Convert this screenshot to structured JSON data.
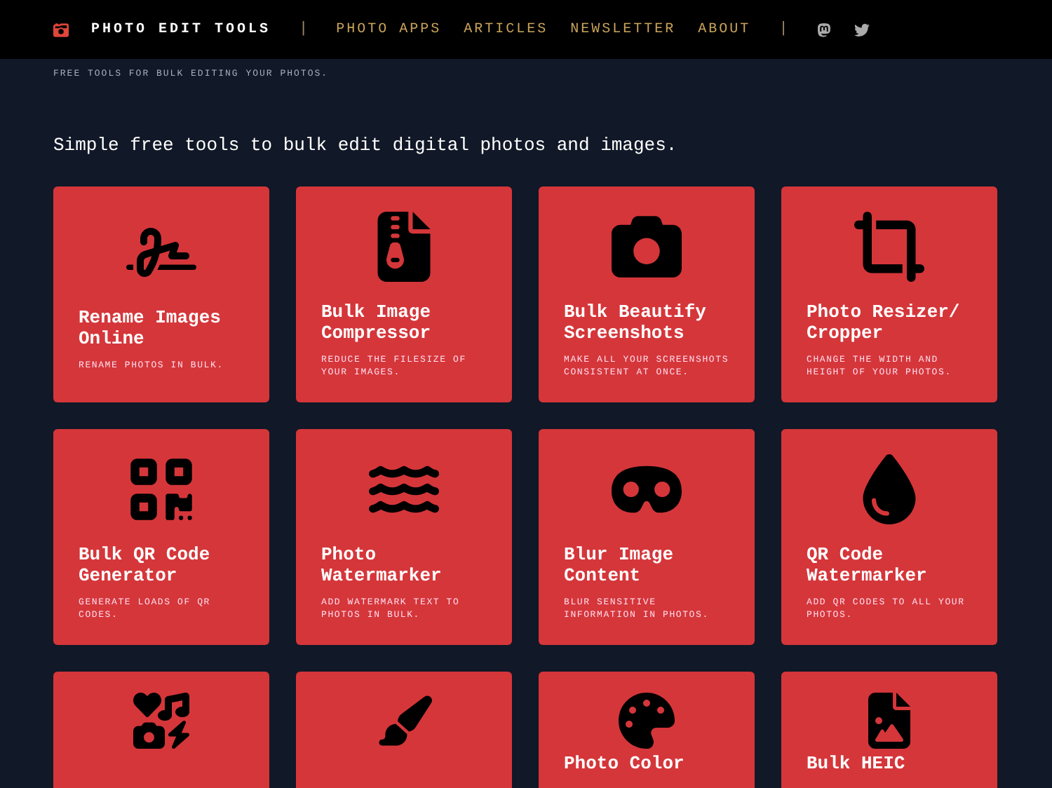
{
  "header": {
    "brand": "PHOTO EDIT TOOLS",
    "separator": "|",
    "nav": [
      "PHOTO APPS",
      "ARTICLES",
      "NEWSLETTER",
      "ABOUT"
    ],
    "separator_2": "|"
  },
  "tagline": "FREE TOOLS FOR BULK EDITING YOUR PHOTOS.",
  "intro": "Simple free tools to bulk edit digital photos and images.",
  "tools": [
    {
      "kind": "full",
      "title": "Rename Images Online",
      "description": "RENAME PHOTOS IN BULK."
    },
    {
      "kind": "full",
      "title": "Bulk Image Compressor",
      "description": "REDUCE THE FILESIZE OF YOUR IMAGES."
    },
    {
      "kind": "full",
      "title": "Bulk Beautify Screenshots",
      "description": "MAKE ALL YOUR SCREENSHOTS CONSISTENT AT ONCE."
    },
    {
      "kind": "full",
      "title": "Photo Resizer/ Cropper",
      "description": "CHANGE THE WIDTH AND HEIGHT OF YOUR PHOTOS."
    },
    {
      "kind": "full",
      "title": "Bulk QR Code Generator",
      "description": "GENERATE LOADS OF QR CODES."
    },
    {
      "kind": "full",
      "title": "Photo Watermarker",
      "description": "ADD WATERMARK TEXT TO PHOTOS IN BULK."
    },
    {
      "kind": "full",
      "title": "Blur Image Content",
      "description": "BLUR SENSITIVE INFORMATION IN PHOTOS."
    },
    {
      "kind": "full",
      "title": "QR Code Watermarker",
      "description": "ADD QR CODES TO ALL YOUR PHOTOS."
    },
    {
      "kind": "cut"
    },
    {
      "kind": "cut"
    },
    {
      "kind": "cut",
      "title": "Photo Color"
    },
    {
      "kind": "cut",
      "title": "Bulk HEIC"
    }
  ]
}
